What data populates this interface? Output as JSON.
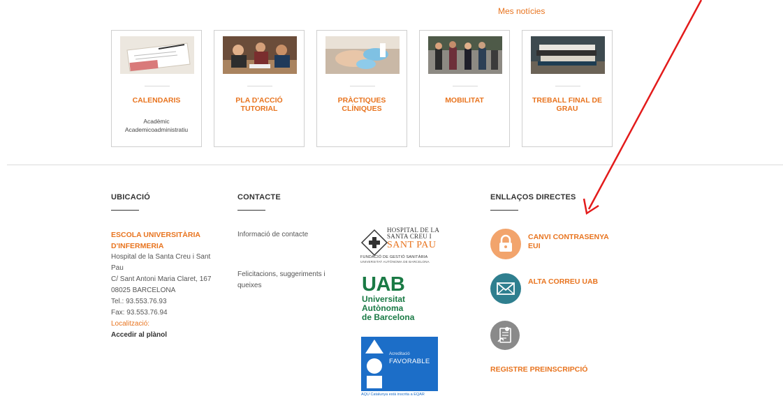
{
  "top_link": {
    "label": "Mes notícies"
  },
  "cards": [
    {
      "title": "CALENDARIS",
      "subtitle_1": "Acadèmic",
      "subtitle_2": "Academicoadministratiu",
      "image": "calendar-documents-photo"
    },
    {
      "title": "PLA D'ACCIÓ TUTORIAL",
      "image": "students-meeting-photo"
    },
    {
      "title": "PRÀCTIQUES CLÍNIQUES",
      "image": "clinical-gloves-photo"
    },
    {
      "title": "MOBILITAT",
      "image": "students-walking-photo"
    },
    {
      "title": "TREBALL FINAL DE GRAU",
      "image": "books-stack-photo"
    }
  ],
  "footer": {
    "ubicacio": {
      "heading": "UBICACIÓ",
      "school": "ESCOLA UNIVERSITÀRIA D'INFERMERIA",
      "address": [
        "Hospital de la Santa Creu i Sant Pau",
        "C/ Sant Antoni Maria Claret, 167",
        "08025 BARCELONA",
        "Tel.: 93.553.76.93",
        "Fax: 93.553.76.94"
      ],
      "localitzacio_label": "Localització:",
      "map_link": "Accedir al plànol"
    },
    "contacte": {
      "heading": "CONTACTE",
      "contact_link": "Informació de contacte",
      "feedback_link": "Felicitacions, suggeriments i queixes"
    },
    "logos": {
      "sant_pau_line1": "HOSPITAL DE LA",
      "sant_pau_line2": "SANTA CREU I",
      "sant_pau_line3": "SANT PAU",
      "sant_pau_line4": "FUNDACIÓ DE GESTIÓ SANITÀRIA",
      "sant_pau_line5": "UNIVERSITAT AUTÒNOMA DE BARCELONA",
      "uab_short": "UAB",
      "uab_line1": "Universitat",
      "uab_line2": "Autònoma",
      "uab_line3": "de Barcelona",
      "aqu_line1": "Acreditació",
      "aqu_line2": "FAVORABLE",
      "aqu_caption": "AQU Catalunya està inscrita a EQAR"
    },
    "enllacos": {
      "heading": "ENLLAÇOS DIRECTES",
      "items": [
        {
          "label": "CANVI CONTRASENYA EUI",
          "icon": "lock-icon",
          "color": "#f2a46c"
        },
        {
          "label": "ALTA CORREU UAB",
          "icon": "mail-icon",
          "color": "#2f7f8f"
        },
        {
          "label": "REGISTRE PREINSCRIPCIÓ",
          "icon": "register-icon",
          "color": "#8a8a8a"
        }
      ]
    }
  },
  "colors": {
    "accent": "#e8741f",
    "annotation_arrow": "#e31b1b"
  }
}
